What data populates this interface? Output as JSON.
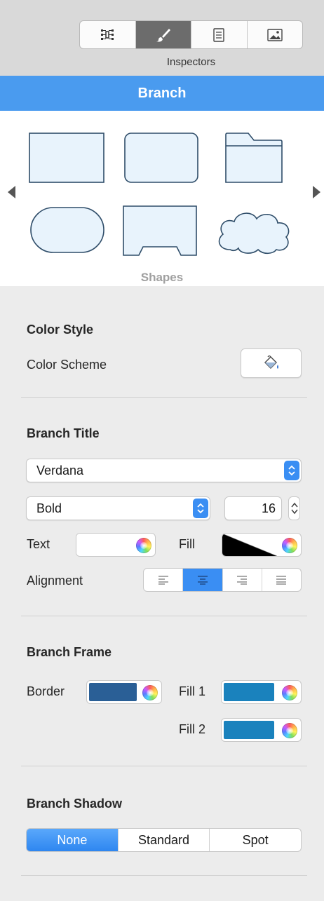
{
  "toolbar": {
    "segments": [
      {
        "icon": "outline-icon",
        "active": false
      },
      {
        "icon": "brush-icon",
        "active": true
      },
      {
        "icon": "document-icon",
        "active": false
      },
      {
        "icon": "image-icon",
        "active": false
      }
    ],
    "label": "Inspectors"
  },
  "header": {
    "title": "Branch"
  },
  "shapes": {
    "label": "Shapes",
    "items": [
      "rectangle",
      "rounded-rectangle",
      "folder",
      "pill",
      "tab-rectangle",
      "cloud"
    ],
    "prev_icon": "triangle-left-icon",
    "next_icon": "triangle-right-icon"
  },
  "color_style": {
    "title": "Color Style",
    "scheme_label": "Color Scheme",
    "scheme_icon": "paint-bucket-icon"
  },
  "branch_title": {
    "title": "Branch Title",
    "font_family": "Verdana",
    "font_style": "Bold",
    "font_size": "16",
    "text_label": "Text",
    "fill_label": "Fill",
    "alignment_label": "Alignment",
    "alignment_options": [
      "left",
      "center",
      "right",
      "justify"
    ],
    "alignment_selected": "center",
    "text_color": "#ffffff",
    "fill_color": "#000000"
  },
  "branch_frame": {
    "title": "Branch Frame",
    "border_label": "Border",
    "fill1_label": "Fill 1",
    "fill2_label": "Fill 2",
    "border_color": "#2a5f96",
    "fill1_color": "#1a82bd",
    "fill2_color": "#1a82bd"
  },
  "branch_shadow": {
    "title": "Branch Shadow",
    "options": [
      "None",
      "Standard",
      "Spot"
    ],
    "selected": "None"
  },
  "colors": {
    "accent": "#4a9bef",
    "shape_fill": "#e8f3fc",
    "shape_stroke": "#2f4d69"
  }
}
